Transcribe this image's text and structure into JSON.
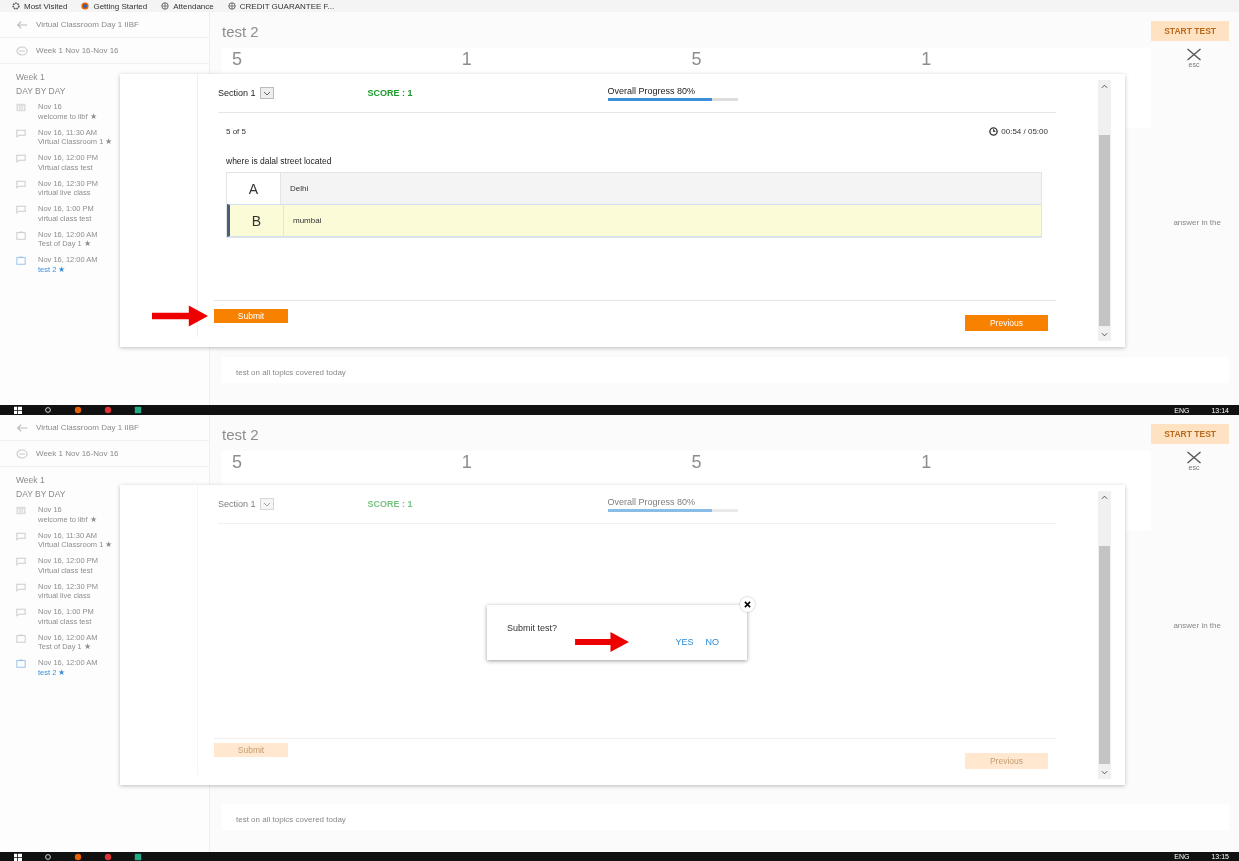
{
  "bookmarks_bar": {
    "items": [
      {
        "label": "Most Visited",
        "kind": "gear"
      },
      {
        "label": "Getting Started",
        "kind": "browser"
      },
      {
        "label": "Attendance",
        "kind": "globe"
      },
      {
        "label": "CREDIT GUARANTEE F...",
        "kind": "globe"
      }
    ]
  },
  "screens": [
    {
      "sidebar": {
        "course": "Virtual Classroom Day 1 IIBF",
        "week_range": "Week 1 Nov 16-Nov 16",
        "week": "Week 1",
        "heading": "DAY BY DAY",
        "items": [
          {
            "kind": "calendar",
            "time": "Nov 16",
            "title": "welcome to iibf ★",
            "selected": false
          },
          {
            "kind": "chat",
            "time": "Nov 16, 11:30 AM",
            "title": "Virtual Classroom 1 ★",
            "selected": false
          },
          {
            "kind": "chat",
            "time": "Nov 16, 12:00 PM",
            "title": "Virtual class test",
            "selected": false
          },
          {
            "kind": "chat",
            "time": "Nov 16, 12:30 PM",
            "title": "virtual live class",
            "selected": false
          },
          {
            "kind": "chat",
            "time": "Nov 16, 1:00 PM",
            "title": "virtual class test",
            "selected": false
          },
          {
            "kind": "clipboard",
            "time": "Nov 16, 12:00 AM",
            "title": "Test of Day 1 ★",
            "selected": false
          },
          {
            "kind": "clipboard",
            "time": "Nov 16, 12:00 AM",
            "title": "test 2 ★",
            "selected": true
          }
        ]
      },
      "main": {
        "title": "test 2",
        "start_button": "START TEST",
        "stats": [
          "5",
          "1",
          "5",
          "1"
        ],
        "close_hint": "esc",
        "side_note": "answer in the",
        "description": "test on all topics covered today"
      },
      "quiz": {
        "faded": false,
        "section": "Section 1",
        "score": "SCORE : 1",
        "progress_label": "Overall Progress 80%",
        "level": 0.8,
        "counter": "5 of 5",
        "timer": "00:54 / 05:00",
        "question": "where is dalal street located",
        "options": [
          {
            "letter": "A",
            "text": "Delhi",
            "selected": false
          },
          {
            "letter": "B",
            "text": "mumbai",
            "selected": true
          }
        ],
        "submit": {
          "label": "Submit",
          "pointed": true
        },
        "previous": "Previous"
      },
      "taskbar": {
        "language": "ENG",
        "time": "13:14"
      }
    },
    {
      "sidebar": {
        "course": "Virtual Classroom Day 1 IIBF",
        "week_range": "Week 1 Nov 16-Nov 16",
        "week": "Week 1",
        "heading": "DAY BY DAY",
        "items": [
          {
            "kind": "calendar",
            "time": "Nov 16",
            "title": "welcome to iibf ★",
            "selected": false
          },
          {
            "kind": "chat",
            "time": "Nov 16, 11:30 AM",
            "title": "Virtual Classroom 1 ★",
            "selected": false
          },
          {
            "kind": "chat",
            "time": "Nov 16, 12:00 PM",
            "title": "Virtual class test",
            "selected": false
          },
          {
            "kind": "chat",
            "time": "Nov 16, 12:30 PM",
            "title": "virtual live class",
            "selected": false
          },
          {
            "kind": "chat",
            "time": "Nov 16, 1:00 PM",
            "title": "virtual class test",
            "selected": false
          },
          {
            "kind": "clipboard",
            "time": "Nov 16, 12:00 AM",
            "title": "Test of Day 1 ★",
            "selected": false
          },
          {
            "kind": "clipboard",
            "time": "Nov 16, 12:00 AM",
            "title": "test 2 ★",
            "selected": true
          }
        ]
      },
      "main": {
        "title": "test 2",
        "start_button": "START TEST",
        "stats": [
          "5",
          "1",
          "5",
          "1"
        ],
        "close_hint": "esc",
        "side_note": "answer in the",
        "description": "test on all topics covered today"
      },
      "quiz": {
        "faded": true,
        "section": "Section 1",
        "score": "SCORE : 1",
        "progress_label": "Overall Progress 80%",
        "level": 0.8,
        "submit": {
          "label": "Submit",
          "pointed": false
        },
        "previous": "Previous"
      },
      "dialog": {
        "prompt": "Submit test?",
        "yes": {
          "label": "YES",
          "pointed": true
        },
        "no": "NO"
      },
      "taskbar": {
        "language": "ENG",
        "time": "13:15"
      }
    }
  ]
}
